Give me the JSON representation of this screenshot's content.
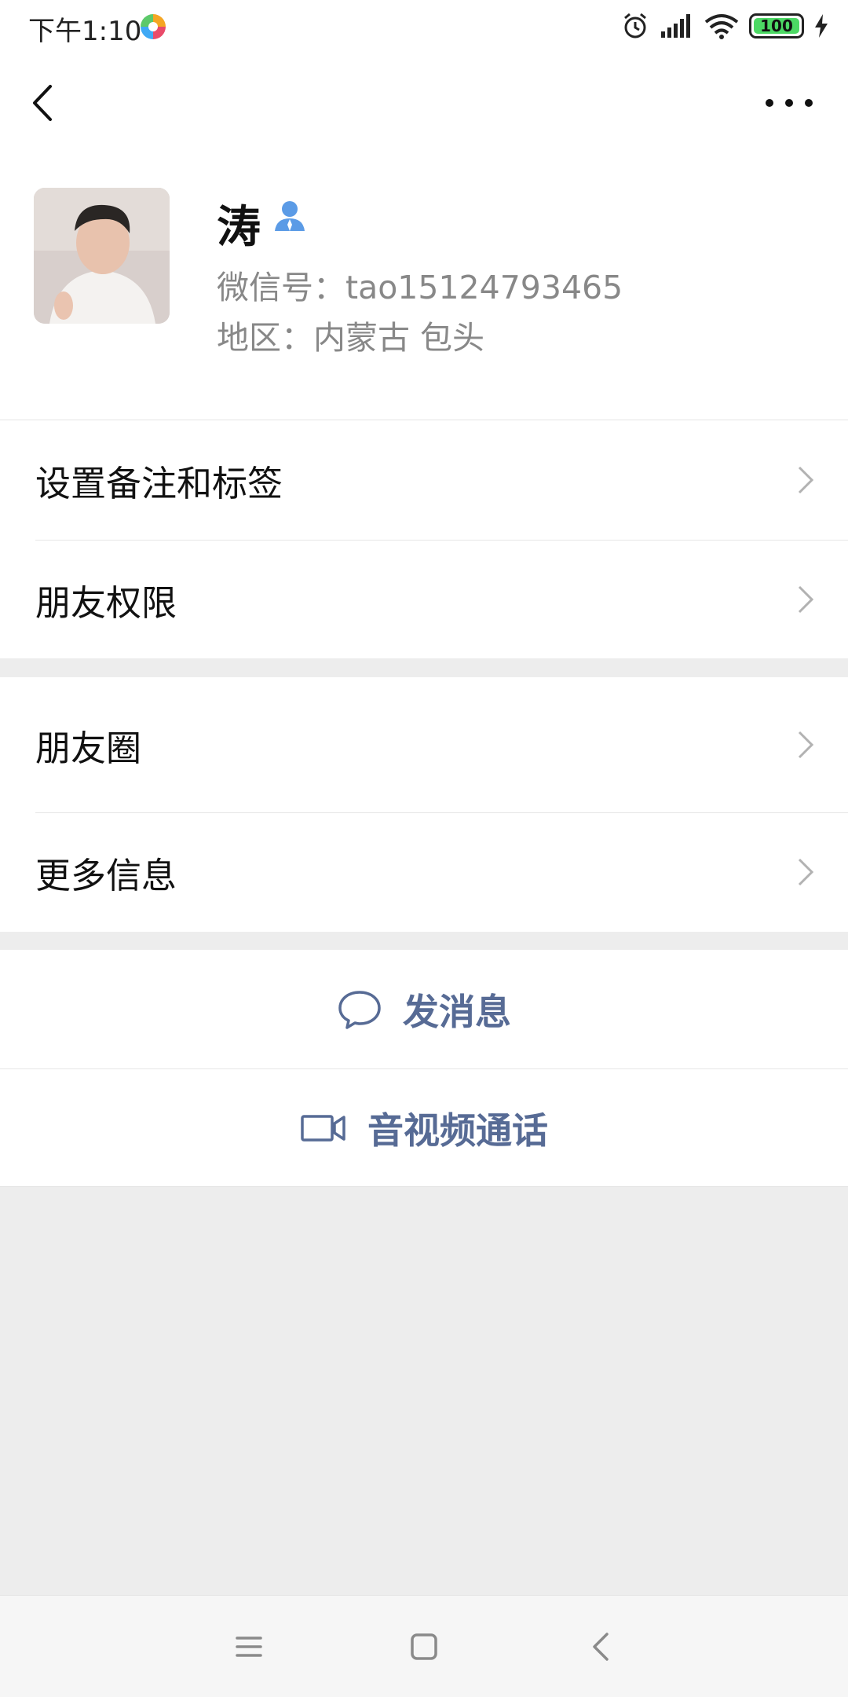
{
  "status_bar": {
    "time": "下午1:10",
    "battery": "100"
  },
  "profile": {
    "name": "涛",
    "wechat_id": "微信号：tao15124793465",
    "region": "地区：内蒙古  包头"
  },
  "menu_group_1": [
    {
      "label": "设置备注和标签"
    },
    {
      "label": "朋友权限"
    }
  ],
  "menu_group_2": [
    {
      "label": "朋友圈"
    },
    {
      "label": "更多信息"
    }
  ],
  "actions": {
    "message_label": "发消息",
    "call_label": "音视频通话"
  },
  "colors": {
    "action_text": "#576b95",
    "background": "#ededed",
    "battery_fill": "#4cd964"
  }
}
